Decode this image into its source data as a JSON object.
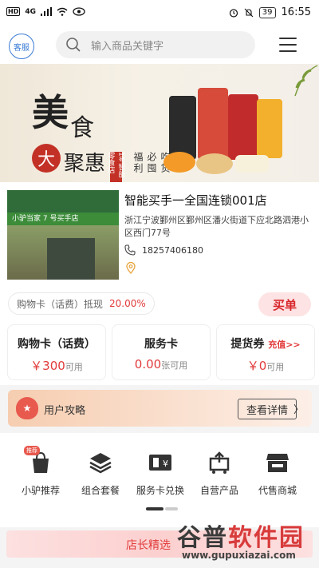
{
  "status_bar": {
    "left_badges": [
      "HD",
      "4G"
    ],
    "battery": "39",
    "time": "16:55"
  },
  "header": {
    "service_label": "客服",
    "search_placeholder": "输入商品关键字"
  },
  "banner": {
    "title_1": "美",
    "title_2": "食",
    "title_3": "大",
    "title_4": "聚惠",
    "tag": "1号智能零食店",
    "vertical_text": "吃货必囤福利",
    "store_sign": "小驴当家  7 号买手店"
  },
  "store": {
    "name": "智能买手一全国连锁001店",
    "address": "浙江宁波鄞州区鄞州区潘火街道下应北路泗港小区西门77号",
    "phone": "18257406180"
  },
  "discount": {
    "label": "购物卡（话费）抵现",
    "rate": "20.00%",
    "buy_label": "买单"
  },
  "cards": [
    {
      "title": "购物卡（话费）",
      "amount": "￥300",
      "unit": "可用"
    },
    {
      "title": "服务卡",
      "amount": "0.00",
      "unit": "张可用"
    },
    {
      "title": "提货券",
      "extra": "充值>>",
      "amount": "￥0",
      "unit": "可用"
    }
  ],
  "strategy": {
    "label": "用户攻略",
    "detail_label": "查看详情",
    "arrow": "〉"
  },
  "shortcuts": [
    {
      "label": "小驴推荐",
      "badge": "推荐"
    },
    {
      "label": "组合套餐"
    },
    {
      "label": "服务卡兑换"
    },
    {
      "label": "自营产品"
    },
    {
      "label": "代售商城"
    }
  ],
  "bottom": {
    "label": "店长精选"
  },
  "watermark": {
    "text_1": "谷普",
    "text_2": "软件园",
    "url": "www.gupuxiazai.com"
  },
  "colors": {
    "accent_red": "#e23b3b",
    "service_blue": "#3a7bd5",
    "page_bg": "#f4f4f4"
  }
}
